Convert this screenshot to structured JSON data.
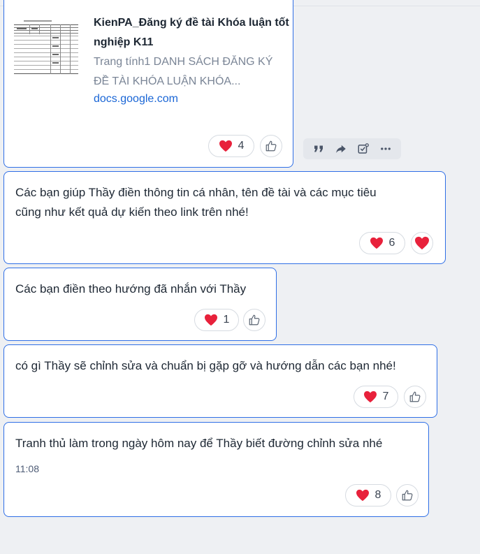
{
  "colors": {
    "border": "#2f6fe6",
    "heart": "#e8213b",
    "link": "#1a66d6"
  },
  "link_message": {
    "title": "KienPA_Đăng ký đề tài Khóa luận tốt nghiệp K11",
    "description": "Trang tính1 DANH SÁCH ĐĂNG KÝ ĐỀ TÀI KHÓA LUẬN KHÓA...",
    "domain": "docs.google.com",
    "heart_count": "4"
  },
  "messages": [
    {
      "text": "Các bạn giúp Thầy điền thông tin cá nhân, tên đề tài và các mục tiêu\ncũng như kết quả dự kiến theo link trên nhé!",
      "heart_count": "6"
    },
    {
      "text": "Các bạn điền theo hướng đã nhắn với Thầy",
      "heart_count": "1"
    },
    {
      "text": "có gì Thầy sẽ chỉnh sửa và chuẩn bị gặp gỡ và hướng dẫn các bạn nhé!",
      "heart_count": "7"
    },
    {
      "text": "Tranh thủ làm trong ngày hôm nay để Thầy biết đường chỉnh sửa nhé",
      "time": "11:08",
      "heart_count": "8"
    }
  ],
  "hover_actions": [
    "quote-icon",
    "forward-icon",
    "add-task-icon",
    "more-icon"
  ]
}
